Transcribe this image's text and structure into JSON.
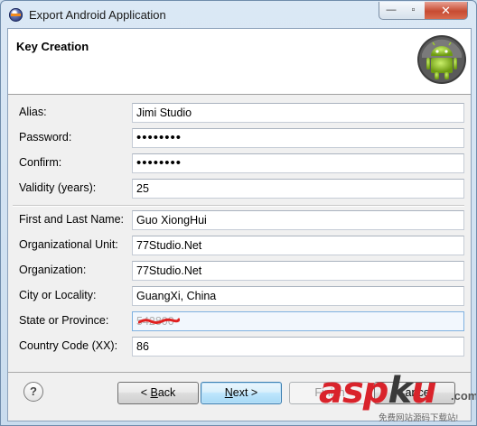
{
  "window": {
    "title": "Export Android Application",
    "min_label": "—",
    "max_label": "▫",
    "close_label": "✕"
  },
  "header": {
    "title": "Key Creation"
  },
  "form": {
    "alias": {
      "label": "Alias:",
      "value": "Jimi Studio"
    },
    "password": {
      "label": "Password:",
      "value": "••••••••"
    },
    "confirm": {
      "label": "Confirm:",
      "value": "••••••••"
    },
    "validity": {
      "label": "Validity (years):",
      "value": "25"
    },
    "name": {
      "label": "First and Last Name:",
      "value": "Guo XiongHui"
    },
    "org_unit": {
      "label": "Organizational Unit:",
      "value": "77Studio.Net"
    },
    "organization": {
      "label": "Organization:",
      "value": "77Studio.Net"
    },
    "city": {
      "label": "City or Locality:",
      "value": "GuangXi, China"
    },
    "state": {
      "label": "State or Province:",
      "value": "542800"
    },
    "country": {
      "label": "Country Code (XX):",
      "value": "86"
    }
  },
  "buttons": {
    "help": "?",
    "back_pre": "< ",
    "back_key": "B",
    "back_post": "ack",
    "next_key": "N",
    "next_post": "ext >",
    "finish": "Finish",
    "cancel": "Cancel"
  },
  "watermark": {
    "a": "asp",
    "b": "k",
    "c": "u",
    "tld": ".com",
    "sub": "免费网站源码下载站!"
  },
  "colors": {
    "accent_focus": "#7fb1e0",
    "redaction": "#e02020"
  }
}
